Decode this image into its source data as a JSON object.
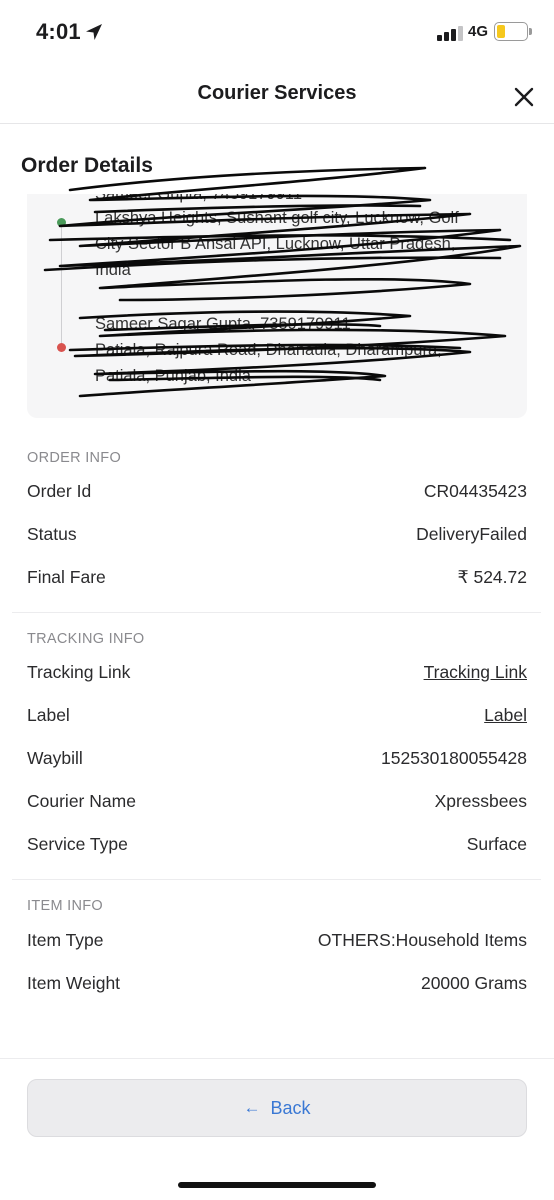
{
  "status_bar": {
    "time": "4:01",
    "network": "4G",
    "battery_level": 0.3,
    "battery_color": "#f6c81d"
  },
  "header": {
    "title": "Courier Services",
    "close_icon": "close-icon"
  },
  "order_details": {
    "title": "Order Details",
    "pickup": {
      "name_line": "Sameer Gupta, 7459179911",
      "address_lines": [
        "Lakshya Heights, Sushant golf city, Lucknow, Golf",
        "City Sector B Ansal API, Lucknow, Uttar Pradesh,",
        "India"
      ],
      "dot_color": "#4a9a5a"
    },
    "drop": {
      "name_line": "Sameer Sagar Gupta, 7359179911",
      "address_lines": [
        "Patiala, Rajpura Road, Dhanaula, Dharampura,",
        "Patiala, Punjab, India"
      ],
      "dot_color": "#d9534f"
    }
  },
  "order_info": {
    "label": "ORDER INFO",
    "rows": [
      {
        "key": "Order Id",
        "value": "CR04435423"
      },
      {
        "key": "Status",
        "value": "DeliveryFailed"
      },
      {
        "key": "Final Fare",
        "value": "₹ 524.72"
      }
    ]
  },
  "tracking_info": {
    "label": "TRACKING INFO",
    "rows": [
      {
        "key": "Tracking Link",
        "value": "Tracking Link"
      },
      {
        "key": "Label",
        "value": "Label"
      },
      {
        "key": "Waybill",
        "value": "152530180055428"
      },
      {
        "key": "Courier Name",
        "value": "Xpressbees"
      },
      {
        "key": "Service Type",
        "value": "Surface"
      }
    ]
  },
  "item_info": {
    "label": "ITEM INFO",
    "rows": [
      {
        "key": "Item Type",
        "value": "OTHERS:Household Items"
      },
      {
        "key": "Item Weight",
        "value": "20000 Grams"
      }
    ]
  },
  "footer": {
    "back_label": "Back",
    "accent_color": "#3a78d4"
  }
}
